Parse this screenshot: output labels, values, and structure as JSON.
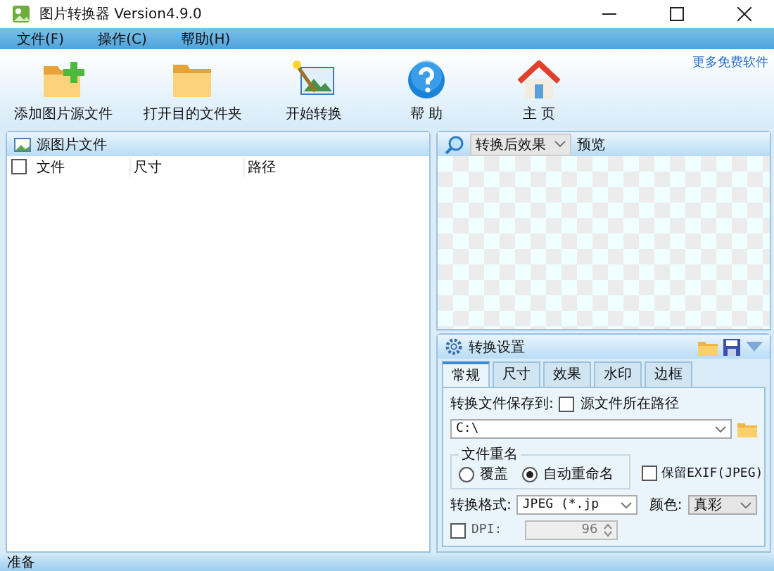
{
  "window": {
    "title": "图片转换器 Version4.9.0"
  },
  "menu": [
    "文件(F)",
    "操作(C)",
    "帮助(H)"
  ],
  "toolbar": [
    {
      "label": "添加图片源文件",
      "kind": "add-folder"
    },
    {
      "label": "打开目的文件夹",
      "kind": "folder"
    },
    {
      "label": "开始转换",
      "kind": "convert"
    },
    {
      "label": "帮 助",
      "kind": "help"
    },
    {
      "label": "主 页",
      "kind": "home"
    }
  ],
  "link": "更多免费软件",
  "source_panel": {
    "title": "源图片文件",
    "select_all_checked": false,
    "columns": [
      "文件",
      "尺寸",
      "路径"
    ]
  },
  "preview": {
    "mode": "转换后效果",
    "label": "预览"
  },
  "settings": {
    "title": "转换设置",
    "tabs": [
      {
        "label": "常规",
        "selected": true
      },
      {
        "label": "尺寸",
        "selected": false
      },
      {
        "label": "效果",
        "selected": false
      },
      {
        "label": "水印",
        "selected": false
      },
      {
        "label": "边框",
        "selected": false
      }
    ],
    "save_to_label": "转换文件保存到:",
    "same_path": {
      "label": "源文件所在路径",
      "checked": false
    },
    "output_path": "C:\\",
    "rename": {
      "title": "文件重名",
      "options": [
        {
          "label": "覆盖",
          "selected": false
        },
        {
          "label": "自动重命名",
          "selected": true
        }
      ]
    },
    "keep_exif": {
      "label": "保留EXIF(JPEG)",
      "checked": false
    },
    "format_label": "转换格式:",
    "format": "JPEG (*.jp",
    "color_label": "颜色:",
    "color_mode": "真彩",
    "dpi": {
      "label": "DPI:",
      "checked": false,
      "value": "96"
    }
  },
  "status_bar": "准备"
}
